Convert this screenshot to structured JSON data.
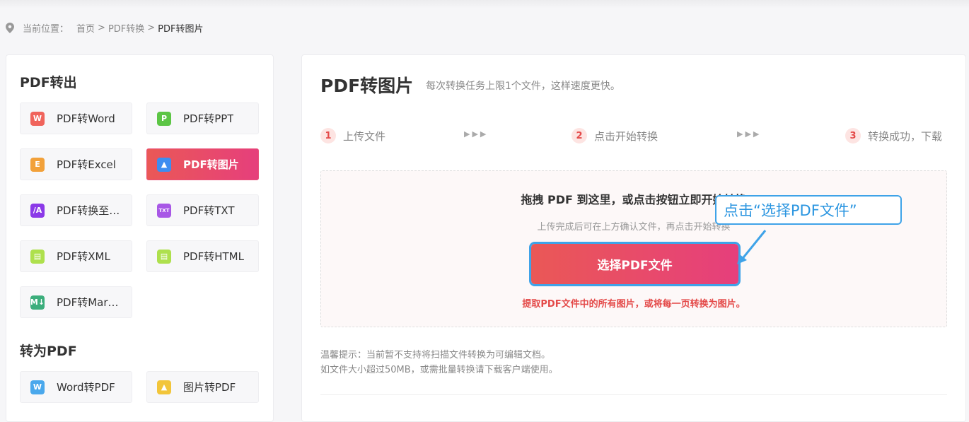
{
  "breadcrumb": {
    "prefix": "当前位置：",
    "items": [
      "首页",
      "PDF转换",
      "PDF转图片"
    ],
    "separator": ">"
  },
  "sidebar": {
    "sections": [
      {
        "title": "PDF转出",
        "items": [
          {
            "label": "PDF转Word",
            "icon": "word-icon",
            "glyph": "W",
            "color": "#f0645c"
          },
          {
            "label": "PDF转PPT",
            "icon": "ppt-icon",
            "glyph": "P",
            "color": "#5cc545"
          },
          {
            "label": "PDF转Excel",
            "icon": "excel-icon",
            "glyph": "E",
            "color": "#f2a13a"
          },
          {
            "label": "PDF转图片",
            "icon": "image-icon",
            "glyph": "▲",
            "color": "#3d8df0",
            "active": true
          },
          {
            "label": "PDF转换至…",
            "icon": "ai-icon",
            "glyph": "/A",
            "color": "#8b39e8"
          },
          {
            "label": "PDF转TXT",
            "icon": "txt-icon",
            "glyph": "TXT",
            "color": "#a857e6"
          },
          {
            "label": "PDF转XML",
            "icon": "xml-icon",
            "glyph": "▤",
            "color": "#aee04d"
          },
          {
            "label": "PDF转HTML",
            "icon": "html-icon",
            "glyph": "▤",
            "color": "#aee04d"
          },
          {
            "label": "PDF转Mar…",
            "icon": "markdown-icon",
            "glyph": "M↓",
            "color": "#3cae7c"
          }
        ]
      },
      {
        "title": "转为PDF",
        "items": [
          {
            "label": "Word转PDF",
            "icon": "word-icon",
            "glyph": "W",
            "color": "#4aa8ec"
          },
          {
            "label": "图片转PDF",
            "icon": "image-icon",
            "glyph": "▲",
            "color": "#f2c53a"
          }
        ]
      }
    ]
  },
  "main": {
    "title": "PDF转图片",
    "subtitle": "每次转换任务上限1个文件，这样速度更快。",
    "steps": [
      {
        "num": "1",
        "label": "上传文件"
      },
      {
        "num": "2",
        "label": "点击开始转换"
      },
      {
        "num": "3",
        "label": "转换成功，下载"
      }
    ],
    "step_arrows": "▶▶▶",
    "dropzone": {
      "title": "拖拽 PDF 到这里，或点击按钮立即开始转换",
      "hint": "上传完成后可在上方确认文件，再点击开始转换",
      "button": "选择PDF文件",
      "desc": "提取PDF文件中的所有图片，或将每一页转换为图片。"
    },
    "tips": [
      "温馨提示：当前暂不支持将扫描文件转换为可编辑文档。",
      "如文件大小超过50MB，或需批量转换请下载客户端使用。"
    ]
  },
  "callout": {
    "text": "点击“选择PDF文件”"
  },
  "colors": {
    "accent_start": "#ea5856",
    "accent_end": "#e63f7c",
    "callout_blue": "#3fa3e8"
  }
}
